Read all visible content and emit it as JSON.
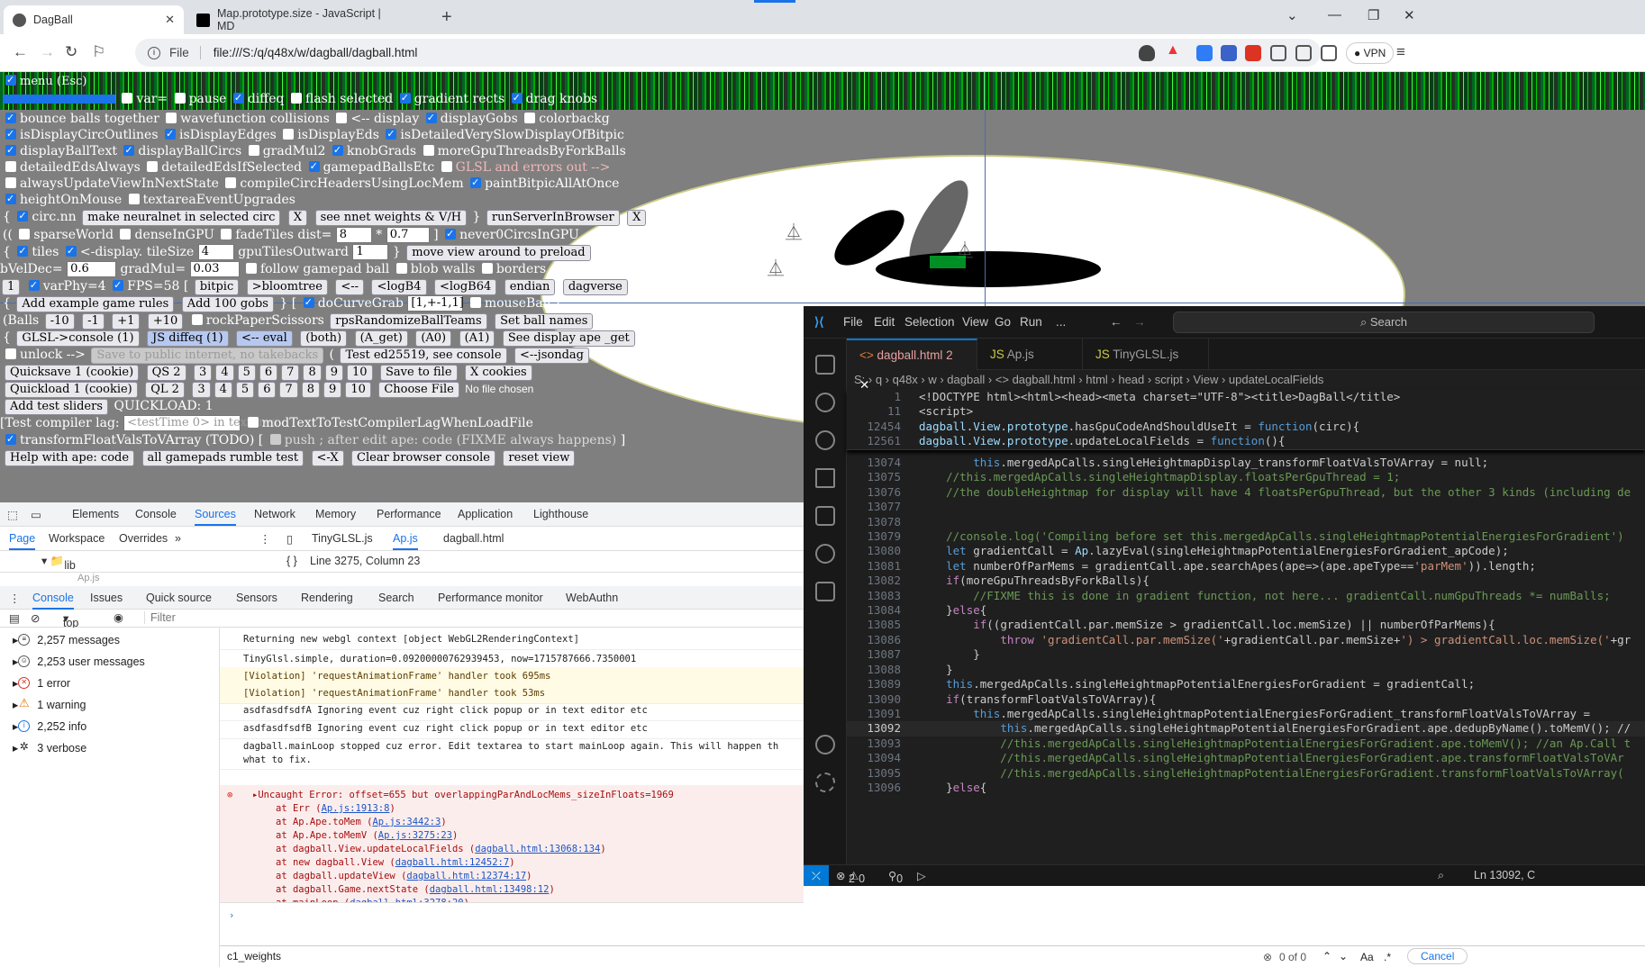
{
  "browser": {
    "tabs": [
      {
        "title": "DagBall"
      },
      {
        "title": "Map.prototype.size - JavaScript | MD"
      }
    ],
    "url": "file:///S:/q/q48x/w/dagball/dagball.html",
    "url_scheme_label": "File",
    "vpn_label": "VPN"
  },
  "page": {
    "title_partial": "menu (Esc)",
    "row1": {
      "var_label": "var=",
      "pause": "pause",
      "diffeq": "diffeq",
      "flash": "flash selected",
      "gradrects": "gradient rects",
      "dragknobs": "drag knobs"
    },
    "row2": [
      "bounce balls together",
      "wavefunction collisions",
      "<-- display",
      "displayGobs",
      "colorbackg"
    ],
    "row3": [
      "isDisplayCircOutlines",
      "isDisplayEdges",
      "isDisplayEds",
      "isDetailedVerySlowDisplayOfBitpic"
    ],
    "row4": [
      "displayBallText",
      "displayBallCircs",
      "gradMul2",
      "knobGrads",
      "moreGpuThreadsByForkBalls"
    ],
    "row5": [
      "detailedEdsAlways",
      "detailedEdsIfSelected",
      "gamepadBallsEtc",
      "GLSL and errors out -->"
    ],
    "row6": [
      "alwaysUpdateViewInNextState",
      "compileCircHeadersUsingLocMem",
      "paintBitpicAllAtOnce"
    ],
    "row7": [
      "heightOnMouse",
      "textareaEventUpgrades"
    ],
    "row8": {
      "circnn": "circ.nn",
      "make": "make neuralnet in selected circ",
      "x1": "X",
      "seennet": "see nnet weights & V/H",
      "runserver": "runServerInBrowser",
      "x2": "X"
    },
    "row9": {
      "sparse": "sparseWorld",
      "dense": "denseInGPU",
      "fade": "fadeTiles dist=",
      "fadeval": "8",
      "mult": "0.7",
      "never": "never0CircsInGPU"
    },
    "row10": {
      "tiles": "tiles",
      "disp": "<-display. tileSize",
      "tilesize": "4",
      "gputiles": "gpuTilesOutward",
      "gpuval": "1",
      "move": "move view around to preload"
    },
    "row11": {
      "bveldec": "bVelDec=",
      "bvelval": "0.6",
      "gradmul": "gradMul=",
      "gradval": "0.03",
      "follow": "follow gamepad ball",
      "blob": "blob walls",
      "borders": "borders"
    },
    "row12": {
      "one": "1",
      "varphy": "varPhy=4",
      "fps": "FPS=58",
      "bitpic": "bitpic",
      "bloom": ">bloomtree",
      "back": "<--",
      "logb4": "<logB4",
      "logb64": "<logB64",
      "endian": "endian",
      "dagverse": "dagverse"
    },
    "row13": {
      "addex": "Add example game rules",
      "add100": "Add 100 gobs",
      "docurve": "doCurveGrab",
      "vec": "[1,+-1,1]",
      "mouseball": "mouseBall"
    },
    "row14": {
      "balls": "(Balls",
      "m10": "-10",
      "m1": "-1",
      "p1": "+1",
      "p10": "+10",
      "rps": "rockPaperScissors",
      "rpsrand": "rpsRandomizeBallTeams",
      "setnames": "Set ball names"
    },
    "row15": {
      "glsl": "GLSL->console (1)",
      "jsdiff": "JS diffeq (1)",
      "eval": "<-- eval",
      "both": "(both)",
      "aget": "(A_get)",
      "a0": "(A0)",
      "a1": "(A1)",
      "seeape": "See display ape _get"
    },
    "row16": {
      "unlock": "unlock -->",
      "save": "Save to public internet, no takebacks",
      "test": "Test ed25519, see console",
      "json": "<--jsondag"
    },
    "row17": {
      "qs": "Quicksave 1 (cookie)",
      "qs2": "QS 2",
      "nums": [
        "3",
        "4",
        "5",
        "6",
        "7",
        "8",
        "9",
        "10"
      ],
      "savefile": "Save to file",
      "xcookies": "X cookies"
    },
    "row18": {
      "ql": "Quickload 1 (cookie)",
      "ql2": "QL 2",
      "nums": [
        "3",
        "4",
        "5",
        "6",
        "7",
        "8",
        "9",
        "10"
      ],
      "choose": "Choose File",
      "nofile": "No file chosen"
    },
    "row19": {
      "addtest": "Add test sliders",
      "quick": "QUICKLOAD: 1"
    },
    "row20": {
      "lag": "[Test compiler lag:",
      "lagval": "<testTime 0> in textarea",
      "mod": "modTextToTestCompilerLagWhenLoadFile"
    },
    "row21": {
      "tfv": "transformFloatValsToVArray (TODO)",
      "push": "push ; after edit ape: code (FIXME always happens)"
    },
    "row22": {
      "help": "Help with ape: code",
      "rumble": "all gamepads rumble test",
      "lx": "<-X",
      "clear": "Clear browser console",
      "reset": "reset view"
    }
  },
  "devtools": {
    "tabs": [
      "Elements",
      "Console",
      "Sources",
      "Network",
      "Memory",
      "Performance",
      "Application",
      "Lighthouse"
    ],
    "selected_tab": "Sources",
    "subtabs": [
      "Page",
      "Workspace",
      "Overrides"
    ],
    "files": [
      "TinyGLSL.js",
      "Ap.js",
      "dagball.html"
    ],
    "tree": [
      "lib",
      "Ap.js"
    ],
    "position": "Line 3275, Column 23",
    "drawer_tabs": [
      "Console",
      "Issues",
      "Quick source",
      "Sensors",
      "Rendering",
      "Search",
      "Performance monitor",
      "WebAuthn"
    ],
    "context": "top",
    "filter_placeholder": "Filter",
    "sidebar": [
      {
        "icon": "list-icon",
        "label": "2,257 messages"
      },
      {
        "icon": "user-icon",
        "label": "2,253 user messages"
      },
      {
        "icon": "error-icon",
        "label": "1 error"
      },
      {
        "icon": "warning-icon",
        "label": "1 warning"
      },
      {
        "icon": "info-icon",
        "label": "2,252 info"
      },
      {
        "icon": "bug-icon",
        "label": "3 verbose"
      }
    ],
    "console_lines": [
      "Returning new webgl context [object WebGL2RenderingContext]",
      "TinyGlsl.simple, duration=0.09200000762939453, now=1715787666.7350001",
      "[Violation] 'requestAnimationFrame' handler took 695ms",
      "[Violation] 'requestAnimationFrame' handler took 53ms",
      "asdfasdfsdfA Ignoring event cuz right click popup or in text editor etc",
      "asdfasdfsdfB Ignoring event cuz right click popup or in text editor etc",
      "dagball.mainLoop stopped cuz error. Edit textarea to start mainLoop again. This will happen th"
    ],
    "console_line_cont": "what to fix.",
    "error": {
      "msg": "Uncaught Error: offset=655 but overlappingParAndLocMems_sizeInFloats=1969",
      "stack": [
        {
          "at": "at Err (",
          "link": "Ap.js:1913:8"
        },
        {
          "at": "at Ap.Ape.toMem (",
          "link": "Ap.js:3442:3"
        },
        {
          "at": "at Ap.Ape.toMemV (",
          "link": "Ap.js:3275:23"
        },
        {
          "at": "at dagball.View.updateLocalFields (",
          "link": "dagball.html:13068:134"
        },
        {
          "at": "at new dagball.View (",
          "link": "dagball.html:12452:7"
        },
        {
          "at": "at dagball.updateView (",
          "link": "dagball.html:12374:17"
        },
        {
          "at": "at dagball.Game.nextState (",
          "link": "dagball.html:13498:12"
        },
        {
          "at": "at mainLoop (",
          "link": "dagball.html:3278:20"
        }
      ]
    },
    "search_value": "c1_weights",
    "search_count": "0 of 0",
    "cancel": "Cancel"
  },
  "vscode": {
    "menu": [
      "File",
      "Edit",
      "Selection",
      "View",
      "Go",
      "Run",
      "..."
    ],
    "search": "Search",
    "tabs": [
      {
        "name": "dagball.html 2",
        "active": true
      },
      {
        "name": "Ap.js"
      },
      {
        "name": "TinyGLSL.js"
      }
    ],
    "breadcrumb": "S: › q › q48x › w › dagball › <> dagball.html › html › head › script › View › updateLocalFields",
    "sticky": [
      {
        "ln": "1",
        "code": "<!DOCTYPE html><html><head><meta charset=\"UTF-8\"><title>DagBall</title>"
      },
      {
        "ln": "11",
        "code": "<script>"
      },
      {
        "ln": "12454",
        "code": "dagball.View.prototype.hasGpuCodeAndShouldUseIt = function(circ){"
      },
      {
        "ln": "12561",
        "code": "dagball.View.prototype.updateLocalFields = function(){"
      }
    ],
    "lines": [
      {
        "ln": "13074",
        "code": "        this.mergedApCalls.singleHeightmapDisplay_transformFloatValsToVArray = null;"
      },
      {
        "ln": "13075",
        "code": "    //this.mergedApCalls.singleHeightmapDisplay.floatsPerGpuThread = 1;"
      },
      {
        "ln": "13076",
        "code": "    //the doubleHeightmap for display will have 4 floatsPerGpuThread, but the other 3 kinds (including de"
      },
      {
        "ln": "13077",
        "code": ""
      },
      {
        "ln": "13078",
        "code": ""
      },
      {
        "ln": "13079",
        "code": "    //console.log('Compiling before set this.mergedApCalls.singleHeightmapPotentialEnergiesForGradient')"
      },
      {
        "ln": "13080",
        "code": "    let gradientCall = Ap.lazyEval(singleHeightmapPotentialEnergiesForGradient_apCode);"
      },
      {
        "ln": "13081",
        "code": "    let numberOfParMems = gradientCall.ape.searchApes(ape=>(ape.apeType=='parMem')).length;"
      },
      {
        "ln": "13082",
        "code": "    if(moreGpuThreadsByForkBalls){"
      },
      {
        "ln": "13083",
        "code": "        //FIXME this is done in gradient function, not here... gradientCall.numGpuThreads *= numBalls;"
      },
      {
        "ln": "13084",
        "code": "    }else{"
      },
      {
        "ln": "13085",
        "code": "        if((gradientCall.par.memSize > gradientCall.loc.memSize) || numberOfParMems){"
      },
      {
        "ln": "13086",
        "code": "            throw 'gradientCall.par.memSize('+gradientCall.par.memSize+') > gradientCall.loc.memSize('+gr"
      },
      {
        "ln": "13087",
        "code": "        }"
      },
      {
        "ln": "13088",
        "code": "    }"
      },
      {
        "ln": "13089",
        "code": "    this.mergedApCalls.singleHeightmapPotentialEnergiesForGradient = gradientCall;"
      },
      {
        "ln": "13090",
        "code": "    if(transformFloatValsToVArray){"
      },
      {
        "ln": "13091",
        "code": "        this.mergedApCalls.singleHeightmapPotentialEnergiesForGradient_transformFloatValsToVArray ="
      },
      {
        "ln": "13092",
        "code": "            this.mergedApCalls.singleHeightmapPotentialEnergiesForGradient.ape.dedupByName().toMemV(); //"
      },
      {
        "ln": "13093",
        "code": "            //this.mergedApCalls.singleHeightmapPotentialEnergiesForGradient.ape.toMemV(); //an Ap.Call t"
      },
      {
        "ln": "13094",
        "code": "            //this.mergedApCalls.singleHeightmapPotentialEnergiesForGradient.ape.transformFloatValsToVAr"
      },
      {
        "ln": "13095",
        "code": "            //this.mergedApCalls.singleHeightmapPotentialEnergiesForGradient.transformFloatValsToVArray("
      },
      {
        "ln": "13096",
        "code": "    }else{"
      }
    ],
    "status_problems": "2",
    "status_warn": "0",
    "status_ports": "0",
    "status_pos": "Ln 13092, C"
  }
}
